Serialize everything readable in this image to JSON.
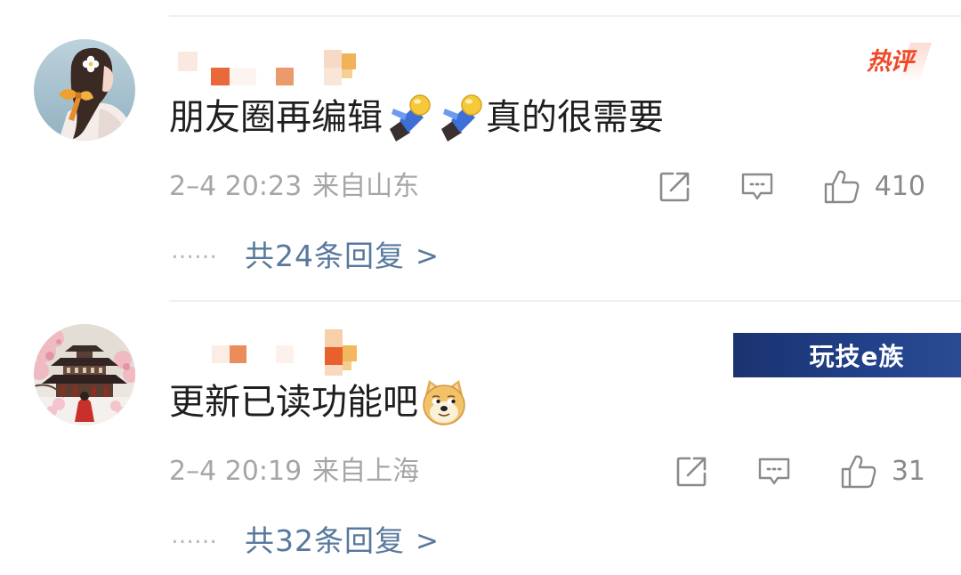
{
  "comments": [
    {
      "hot_badge": "热评",
      "text_part1": "朋友圈再编辑",
      "emojis": [
        "kneeling-figure-emoji",
        "kneeling-figure-emoji"
      ],
      "text_part2": "真的很需要",
      "time": "2–4 20:23",
      "source": "来自山东",
      "like_count": "410",
      "reply_prefix": "……",
      "reply_link": "共24条回复",
      "reply_arrow": ">"
    },
    {
      "text_part1": "更新已读功能吧",
      "emojis": [
        "doge-emoji"
      ],
      "time": "2–4 20:19",
      "source": "来自上海",
      "like_count": "31",
      "reply_prefix": "……",
      "reply_link": "共32条回复",
      "reply_arrow": ">"
    }
  ],
  "watermark": "玩技e族",
  "icons": {
    "share": "share-icon",
    "comment": "comment-icon",
    "like": "like-icon"
  },
  "colors": {
    "text": "#1f1f1f",
    "meta": "#a6a6a6",
    "link": "#58789c",
    "hot": "#ee4a28",
    "icon": "#8a8a8a"
  }
}
